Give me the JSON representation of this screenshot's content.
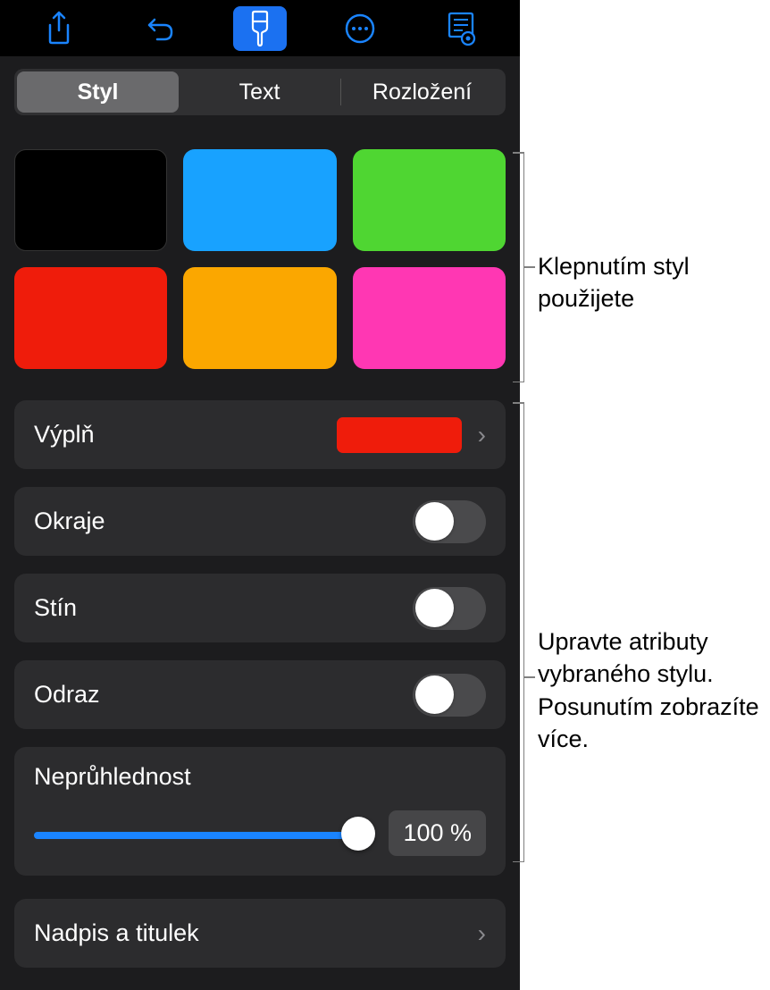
{
  "tabs": {
    "style": "Styl",
    "text": "Text",
    "layout": "Rozložení"
  },
  "swatches": [
    "#000000",
    "#18a2ff",
    "#4fd632",
    "#ef1c0b",
    "#fba700",
    "#ff37b3"
  ],
  "fill": {
    "label": "Výplň",
    "color": "#ef1c0b"
  },
  "toggles": {
    "border": "Okraje",
    "shadow": "Stín",
    "reflection": "Odraz"
  },
  "opacity": {
    "label": "Neprůhlednost",
    "value": "100 %"
  },
  "caption": {
    "label": "Nadpis a titulek"
  },
  "callout1": "Klepnutím styl použijete",
  "callout2": "Upravte atributy vybraného stylu. Posunutím zobrazíte více."
}
